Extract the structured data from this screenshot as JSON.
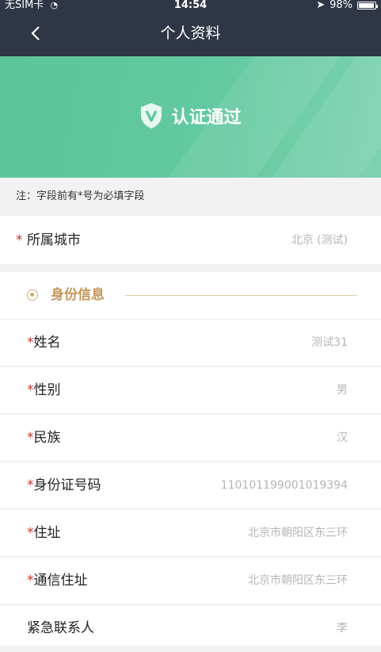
{
  "status": {
    "carrier": "无SIM卡",
    "time": "14:54",
    "battery": "98%",
    "battery_level": 0.98
  },
  "nav": {
    "back_icon": "chevron-left-icon",
    "title": "个人资料"
  },
  "banner": {
    "shield_icon": "verified-shield-icon",
    "status_text": "认证通过",
    "bg_color": "#5dc59a"
  },
  "note": "注：字段前有*号为必填字段",
  "city": {
    "star": "*",
    "label": "所属城市",
    "value": "北京 (测试)"
  },
  "section": {
    "title": "身份信息",
    "accent_color": "#c4955a"
  },
  "fields": [
    {
      "star": "*",
      "label": "姓名",
      "value": "测试31"
    },
    {
      "star": "*",
      "label": "性别",
      "value": "男"
    },
    {
      "star": "*",
      "label": "民族",
      "value": "汉"
    },
    {
      "star": "*",
      "label": "身份证号码",
      "value": "110101199001019394"
    },
    {
      "star": "*",
      "label": "住址",
      "value": "北京市朝阳区东三环"
    },
    {
      "star": "*",
      "label": "通信住址",
      "value": "北京市朝阳区东三环"
    },
    {
      "star": "",
      "label": "紧急联系人",
      "value": "李"
    }
  ]
}
